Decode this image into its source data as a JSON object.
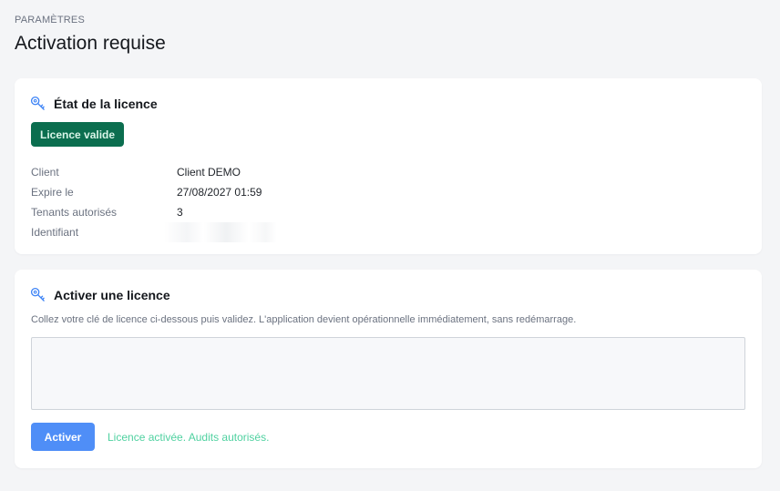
{
  "header": {
    "eyebrow": "PARAMÈTRES",
    "title": "Activation requise"
  },
  "license_status": {
    "title": "État de la licence",
    "icon": "key-icon",
    "badge": "Licence valide",
    "badge_color": "#0b6e4f",
    "rows": [
      {
        "label": "Client",
        "value": "Client DEMO"
      },
      {
        "label": "Expire le",
        "value": "27/08/2027 01:59"
      },
      {
        "label": "Tenants autorisés",
        "value": "3"
      },
      {
        "label": "Identifiant",
        "value": ""
      }
    ]
  },
  "activate": {
    "title": "Activer une licence",
    "icon": "key-icon",
    "help_text": "Collez votre clé de licence ci-dessous puis validez. L'application devient opérationnelle immédiatement, sans redémarrage.",
    "input_value": "",
    "button_label": "Activer",
    "button_color": "#4f8ef7",
    "status_message": "Licence activée. Audits autorisés.",
    "status_color": "#4fd1a0"
  }
}
